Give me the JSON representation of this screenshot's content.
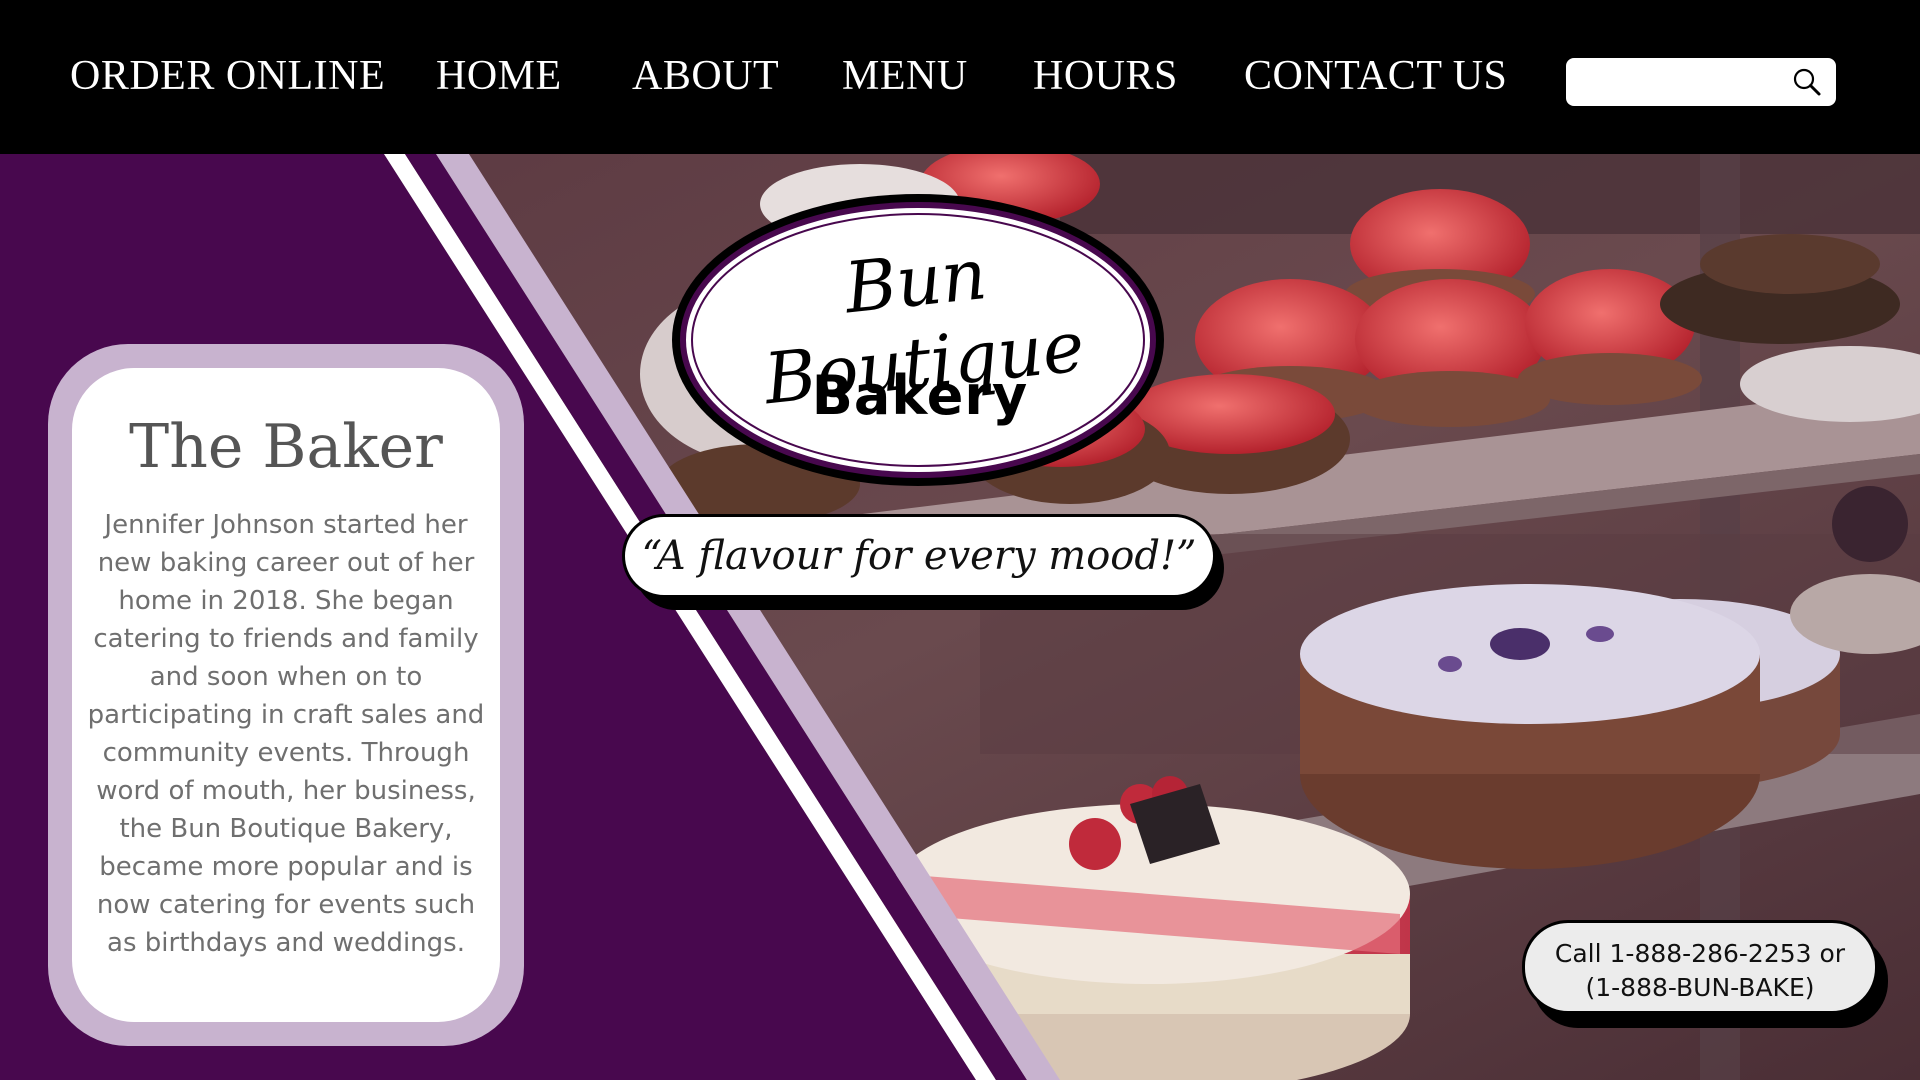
{
  "nav": {
    "items": [
      {
        "label": "ORDER ONLINE"
      },
      {
        "label": "HOME"
      },
      {
        "label": "ABOUT"
      },
      {
        "label": "MENU"
      },
      {
        "label": "HOURS"
      },
      {
        "label": "CONTACT US"
      }
    ],
    "search": {
      "placeholder": "",
      "value": "",
      "icon": "search-icon"
    }
  },
  "logo": {
    "script_text": "Bun Boutique",
    "sub_text": "Bakery"
  },
  "tagline": "“A flavour for every mood!”",
  "baker_card": {
    "title": "The Baker",
    "body": "Jennifer Johnson started her new baking career out of her home in 2018. She began catering to friends and family and soon when on to participating in craft sales and community events. Through word of mouth, her business, the Bun Boutique Bakery, became more popular and is now catering for events such as birthdays and weddings."
  },
  "call": {
    "line1": "Call 1-888-286-2253 or",
    "line2": "(1-888-BUN-BAKE)"
  },
  "colors": {
    "nav_bg": "#000000",
    "purple": "#48084e",
    "lavender": "#c8b3cf",
    "card_text": "#6f6f6f"
  }
}
